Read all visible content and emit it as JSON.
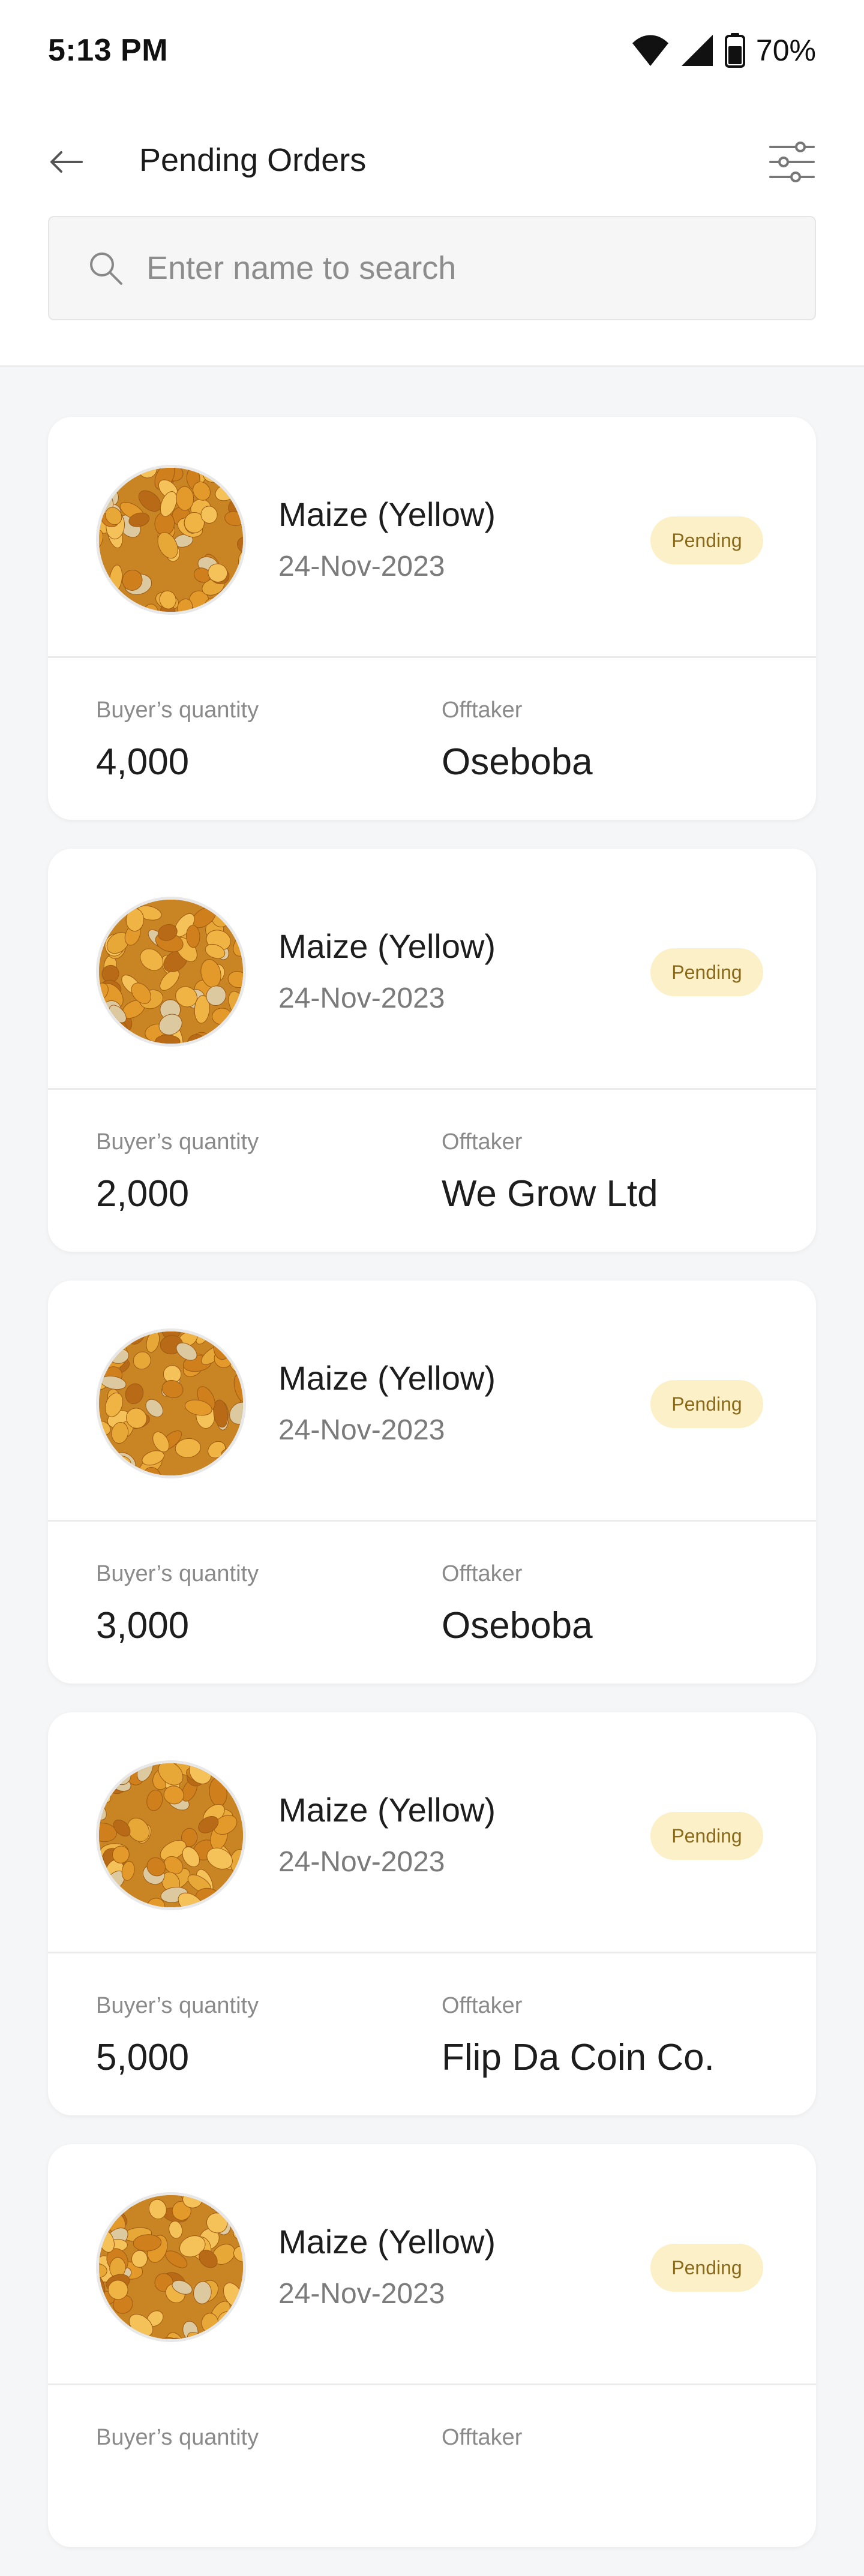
{
  "status_bar": {
    "time": "5:13 PM",
    "battery": "70%"
  },
  "header": {
    "title": "Pending Orders"
  },
  "search": {
    "placeholder": "Enter name to search"
  },
  "labels": {
    "quantity": "Buyer’s quantity",
    "offtaker": "Offtaker"
  },
  "orders": [
    {
      "product": "Maize (Yellow)",
      "date": "24-Nov-2023",
      "status": "Pending",
      "quantity": "4,000",
      "offtaker": "Oseboba"
    },
    {
      "product": "Maize (Yellow)",
      "date": "24-Nov-2023",
      "status": "Pending",
      "quantity": "2,000",
      "offtaker": "We Grow Ltd"
    },
    {
      "product": "Maize (Yellow)",
      "date": "24-Nov-2023",
      "status": "Pending",
      "quantity": "3,000",
      "offtaker": "Oseboba"
    },
    {
      "product": "Maize (Yellow)",
      "date": "24-Nov-2023",
      "status": "Pending",
      "quantity": "5,000",
      "offtaker": "Flip Da Coin Co."
    },
    {
      "product": "Maize (Yellow)",
      "date": "24-Nov-2023",
      "status": "Pending",
      "quantity": "",
      "offtaker": ""
    }
  ],
  "colors": {
    "badge_bg": "#fcf0c9",
    "badge_text": "#8a6a1a",
    "background": "#f5f6f7"
  }
}
